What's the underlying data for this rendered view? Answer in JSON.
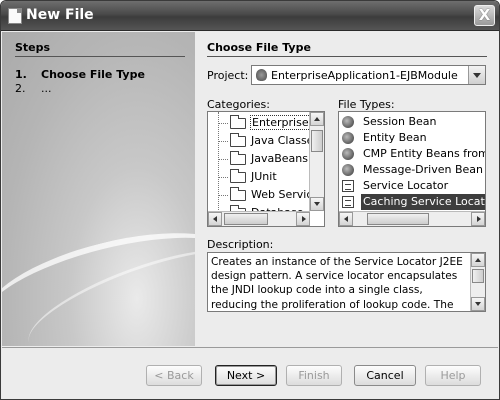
{
  "window": {
    "title": "New File",
    "close_glyph": "X"
  },
  "steps": {
    "heading": "Steps",
    "items": [
      {
        "num": "1.",
        "label": "Choose File Type"
      },
      {
        "num": "2.",
        "label": "..."
      }
    ]
  },
  "main": {
    "heading": "Choose File Type",
    "project": {
      "label": "Project:",
      "value": "EnterpriseApplication1-EJBModule"
    },
    "categories": {
      "label": "Categories:",
      "items": [
        "Enterprise",
        "Java Classes",
        "JavaBeans Objects",
        "JUnit",
        "Web Services",
        "Database"
      ],
      "selected": "Enterprise"
    },
    "file_types": {
      "label": "File Types:",
      "items": [
        {
          "label": "Session Bean",
          "icon": "bean-icon"
        },
        {
          "label": "Entity Bean",
          "icon": "bean-icon"
        },
        {
          "label": "CMP Entity Beans from Database",
          "icon": "bean-icon"
        },
        {
          "label": "Message-Driven Bean",
          "icon": "bean-icon"
        },
        {
          "label": "Service Locator",
          "icon": "document-icon"
        },
        {
          "label": "Caching Service Locator",
          "icon": "document-icon"
        }
      ],
      "selected": "Caching Service Locator"
    },
    "description": {
      "label": "Description:",
      "text": "Creates an instance of the Service Locator J2EE design pattern. A service locator encapsulates the JNDI lookup code into a single class, reducing the proliferation of lookup code. The caching service"
    }
  },
  "buttons": {
    "back": "< Back",
    "next": "Next >",
    "finish": "Finish",
    "cancel": "Cancel",
    "help": "Help"
  }
}
